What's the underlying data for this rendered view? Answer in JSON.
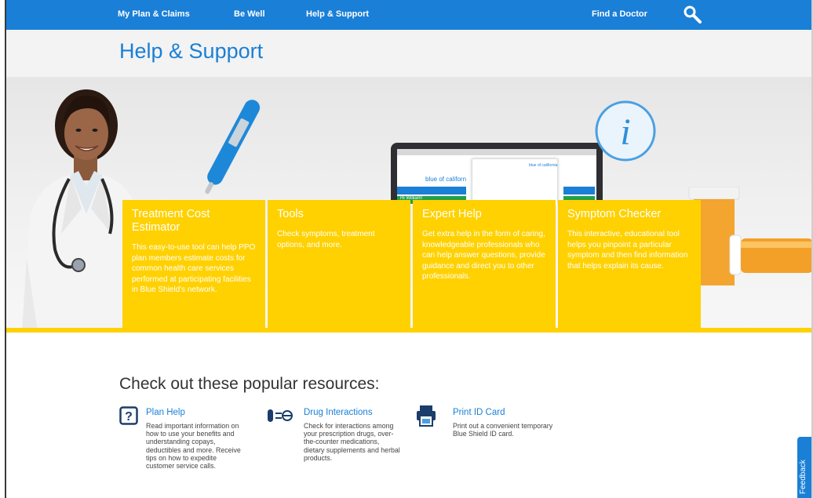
{
  "nav": {
    "items": [
      {
        "label": "My Plan & Claims"
      },
      {
        "label": "Be Well"
      },
      {
        "label": "Help & Support"
      },
      {
        "label": "Find a Doctor"
      }
    ],
    "search_icon": "search-icon"
  },
  "page": {
    "title": "Help & Support"
  },
  "hero": {
    "laptop_screen": {
      "logo_text": "blue of californ",
      "logo_text2": "blue of california",
      "greeting": "Hi William!"
    }
  },
  "cards": [
    {
      "title": "Treatment Cost Estimator",
      "text": "This easy-to-use tool can help PPO plan members estimate costs for common health care services performed at participating facilities in Blue Shield's network."
    },
    {
      "title": "Tools",
      "text": "Check symptoms, treatment options, and more."
    },
    {
      "title": "Expert Help",
      "text": "Get extra help in the form of caring, knowledgeable professionals who can help answer questions, provide guidance and direct you to other professionals."
    },
    {
      "title": "Symptom Checker",
      "text": "This interactive, educational tool helps you pinpoint a particular symptom and then find information that helps explain its cause."
    }
  ],
  "resources": {
    "title": "Check out these popular resources:",
    "items": [
      {
        "icon": "question-icon",
        "link": "Plan Help",
        "desc": "Read important information on how to use your benefits and understanding copays, deductibles and more. Receive tips on how to expedite customer service calls."
      },
      {
        "icon": "pills-icon",
        "link": "Drug Interactions",
        "desc": "Check for interactions among your prescription drugs, over-the-counter medications, dietary supplements and herbal products."
      },
      {
        "icon": "printer-icon",
        "link": "Print ID Card",
        "desc": "Print out a convenient temporary Blue Shield ID card."
      }
    ]
  },
  "feedback": {
    "label": "Feedback"
  },
  "colors": {
    "brand_blue": "#1a7fd6",
    "yellow": "#ffd100"
  }
}
